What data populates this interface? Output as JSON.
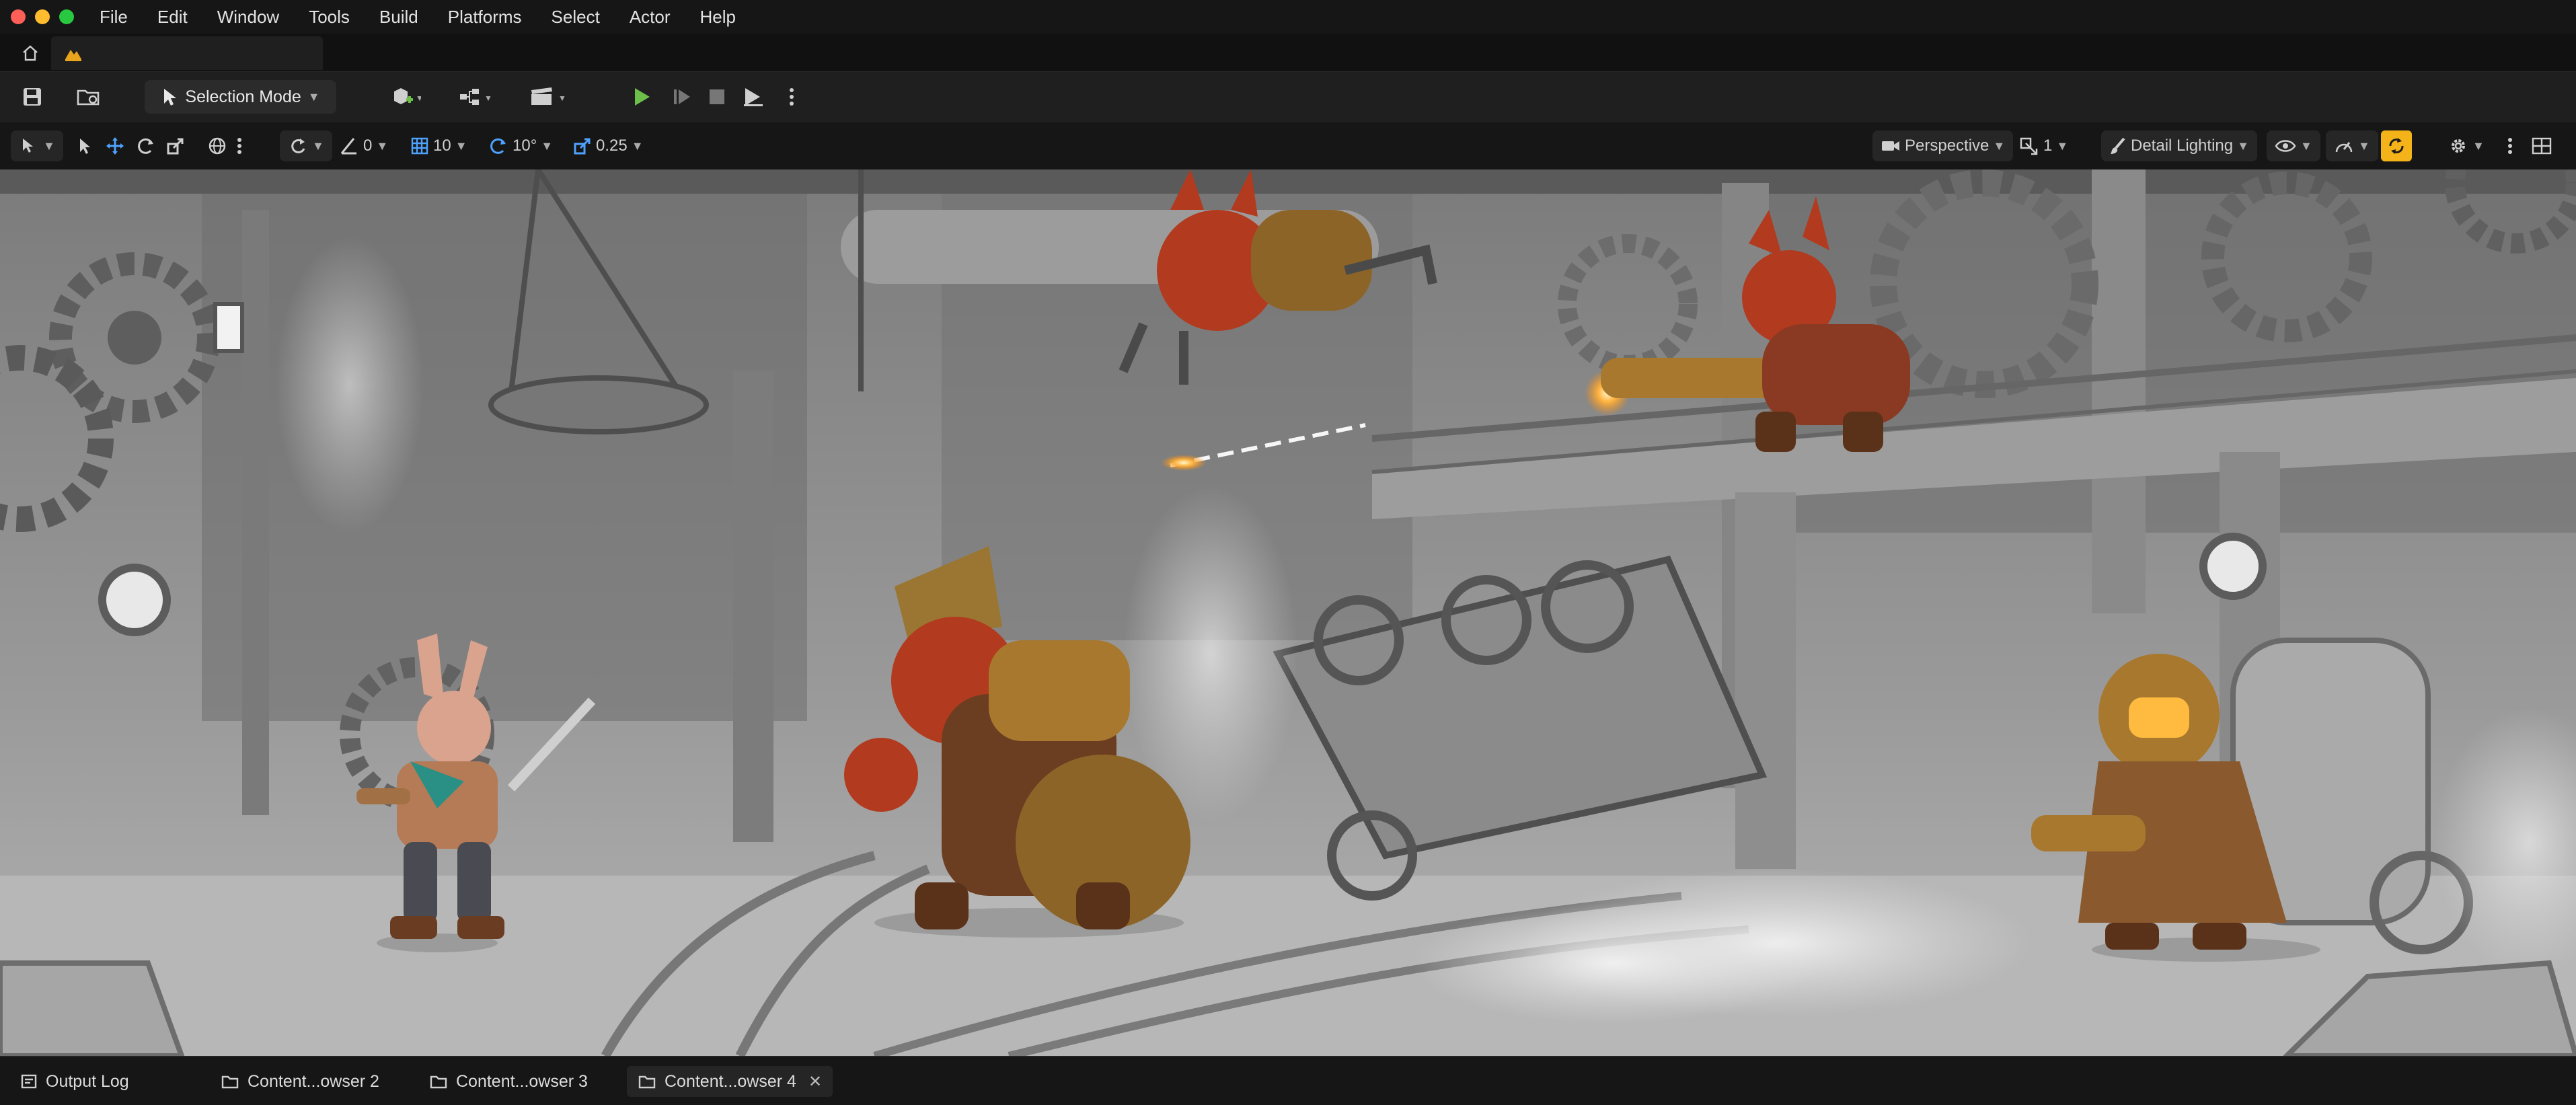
{
  "menubar": {
    "window_controls": [
      "close",
      "minimize",
      "zoom"
    ],
    "items": [
      "File",
      "Edit",
      "Window",
      "Tools",
      "Build",
      "Platforms",
      "Select",
      "Actor",
      "Help"
    ]
  },
  "tabs": {
    "home_icon": "home-icon",
    "level_icon": "level-icon"
  },
  "toolbar": {
    "selection_mode_label": "Selection Mode",
    "play_color": "#6cc04a"
  },
  "viewport_toolbar": {
    "angle_snap": "0",
    "grid_snap": "10",
    "rotation_snap": "10°",
    "scale_snap": "0.25",
    "view_mode": "Perspective",
    "camera_speed": "1",
    "lighting_mode": "Detail Lighting",
    "accent_color": "#f5b31a"
  },
  "bottom_tabs": [
    {
      "label": "Output Log",
      "active": false,
      "closable": false
    },
    {
      "label": "Content...owser 2",
      "active": false,
      "closable": false
    },
    {
      "label": "Content...owser 3",
      "active": false,
      "closable": false
    },
    {
      "label": "Content...owser 4",
      "active": true,
      "closable": true
    }
  ],
  "colors": {
    "window_close": "#fe5f57",
    "window_minimize": "#febc2e",
    "window_zoom": "#28c840",
    "character_red": "#b23a1e",
    "brass": "#a8782e"
  }
}
